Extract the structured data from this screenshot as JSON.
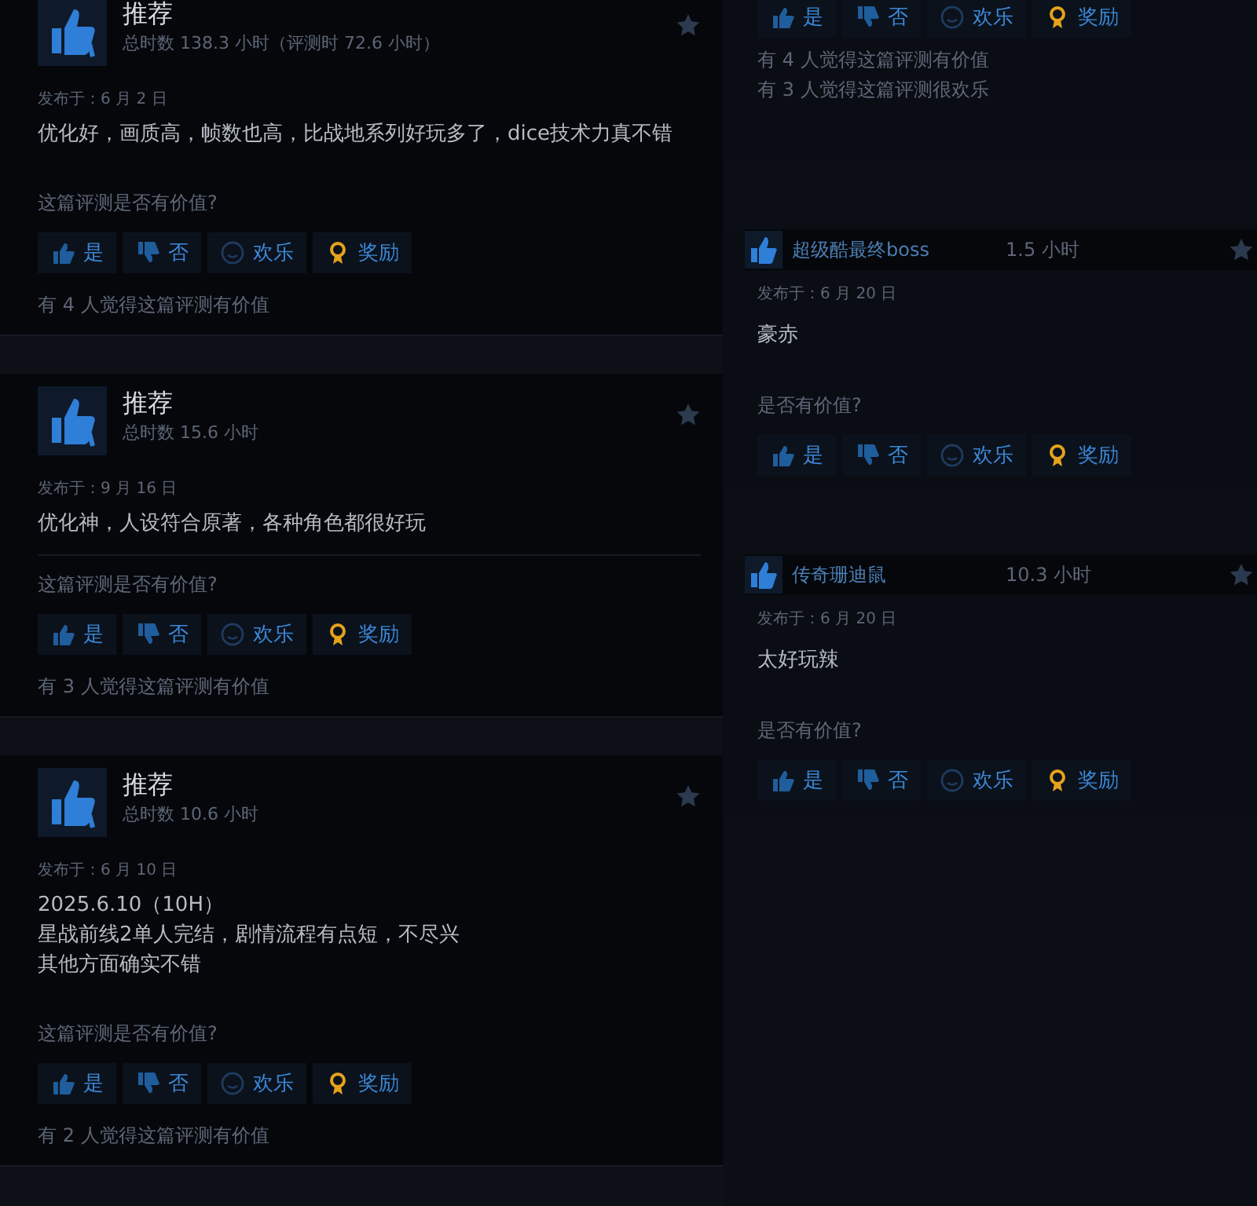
{
  "left_reviews": [
    {
      "title": "推荐",
      "hours": "总时数 138.3 小时（评测时 72.6 小时）",
      "date": "发布于：6 月 2 日",
      "body": [
        "优化好，画质高，帧数也高，比战地系列好玩多了，dice技术力真不错"
      ],
      "question": "这篇评测是否有价值?",
      "buttons": [
        {
          "kind": "yes",
          "label": "是"
        },
        {
          "kind": "no",
          "label": "否"
        },
        {
          "kind": "funny",
          "label": "欢乐"
        },
        {
          "kind": "award",
          "label": "奖励"
        }
      ],
      "helpful": [
        "有 4 人觉得这篇评测有价值"
      ]
    },
    {
      "title": "推荐",
      "hours": "总时数 15.6 小时",
      "date": "发布于：9 月 16 日",
      "body": [
        "优化神，人设符合原著，各种角色都很好玩"
      ],
      "question": "这篇评测是否有价值?",
      "buttons": [
        {
          "kind": "yes",
          "label": "是"
        },
        {
          "kind": "no",
          "label": "否"
        },
        {
          "kind": "funny",
          "label": "欢乐"
        },
        {
          "kind": "award",
          "label": "奖励"
        }
      ],
      "helpful": [
        "有 3 人觉得这篇评测有价值"
      ]
    },
    {
      "title": "推荐",
      "hours": "总时数 10.6 小时",
      "date": "发布于：6 月 10 日",
      "body": [
        "2025.6.10（10H）",
        "星战前线2单人完结，剧情流程有点短，不尽兴",
        "其他方面确实不错"
      ],
      "question": "这篇评测是否有价值?",
      "buttons": [
        {
          "kind": "yes",
          "label": "是"
        },
        {
          "kind": "no",
          "label": "否"
        },
        {
          "kind": "funny",
          "label": "欢乐"
        },
        {
          "kind": "award",
          "label": "奖励"
        }
      ],
      "helpful": [
        "有 2 人觉得这篇评测有价值"
      ]
    }
  ],
  "right_reviews": [
    {
      "buttons": [
        {
          "kind": "yes",
          "label": "是"
        },
        {
          "kind": "no",
          "label": "否"
        },
        {
          "kind": "funny",
          "label": "欢乐"
        },
        {
          "kind": "award",
          "label": "奖励"
        }
      ],
      "helpful": [
        "有 4 人觉得这篇评测有价值",
        "有 3 人觉得这篇评测很欢乐"
      ]
    },
    {
      "name": "超级酷最终boss",
      "hours": "1.5 小时",
      "date": "发布于：6 月 20 日",
      "body": "豪赤",
      "question": "是否有价值?",
      "buttons": [
        {
          "kind": "yes",
          "label": "是"
        },
        {
          "kind": "no",
          "label": "否"
        },
        {
          "kind": "funny",
          "label": "欢乐"
        },
        {
          "kind": "award",
          "label": "奖励"
        }
      ]
    },
    {
      "name": "传奇珊迪鼠",
      "hours": "10.3 小时",
      "date": "发布于：6 月 20 日",
      "body": "太好玩辣",
      "question": "是否有价值?",
      "buttons": [
        {
          "kind": "yes",
          "label": "是"
        },
        {
          "kind": "no",
          "label": "否"
        },
        {
          "kind": "funny",
          "label": "欢乐"
        },
        {
          "kind": "award",
          "label": "奖励"
        }
      ]
    }
  ]
}
